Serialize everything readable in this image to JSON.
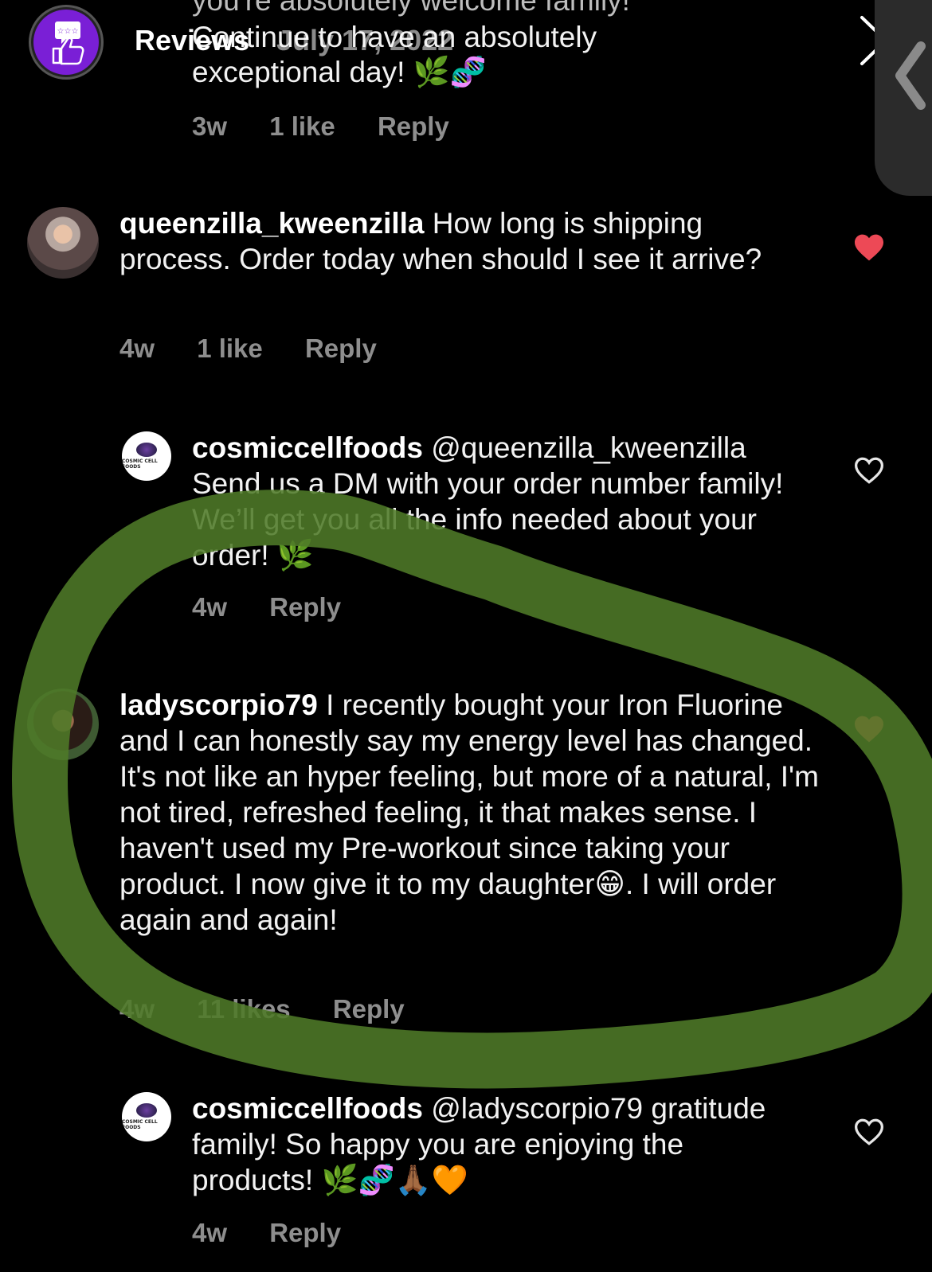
{
  "story_overlay": {
    "title": "Reviews",
    "date": "July 17, 2022",
    "close_glyph": "×",
    "back_glyph": "❮"
  },
  "top_comment": {
    "partial_line": "you're absolutely welcome family!",
    "line2": "Continue to have an absolutely",
    "line3": "exceptional day! 🌿🧬",
    "time": "3w",
    "likes": "1 like",
    "reply": "Reply"
  },
  "comments": [
    {
      "username": "queenzilla_kweenzilla",
      "text": "How long is shipping process. Order today when should I see it arrive?",
      "time": "4w",
      "likes": "1 like",
      "reply": "Reply",
      "liked": true
    },
    {
      "username": "cosmiccellfoods",
      "mention": "@queenzilla_kweenzilla",
      "text": "Send us a DM with your order number family! We’ll get you all the info needed about your order! 🌿",
      "time": "4w",
      "reply": "Reply",
      "liked": false,
      "avatar_text": "COSMIC CELL FOODS"
    },
    {
      "username": "ladyscorpio79",
      "text": "I recently bought your Iron Fluorine and I can honestly say my energy level has changed. It's not like an hyper feeling, but more of a natural, I'm not tired, refreshed feeling, it that makes sense. I haven't used my Pre-workout since taking your product. I now give it to my daughter😁. I will order again and again!",
      "time": "4w",
      "likes": "11 likes",
      "reply": "Reply",
      "liked": true
    },
    {
      "username": "cosmiccellfoods",
      "mention": "@ladyscorpio79",
      "text": "gratitude family! So happy you are enjoying the products! 🌿🧬🙏🏾🧡",
      "time": "4w",
      "reply": "Reply",
      "liked": false,
      "avatar_text": "COSMIC CELL FOODS"
    }
  ],
  "colors": {
    "background": "#000000",
    "meta_gray": "#8e8e8e",
    "liked_heart": "#ed4956",
    "highlight_green": "#4e7a28",
    "badge_purple": "#7a1fd6"
  },
  "icons": [
    "reviews-badge-icon",
    "heart-icon",
    "heart-outline-icon",
    "close-icon",
    "back-chevron-icon"
  ]
}
